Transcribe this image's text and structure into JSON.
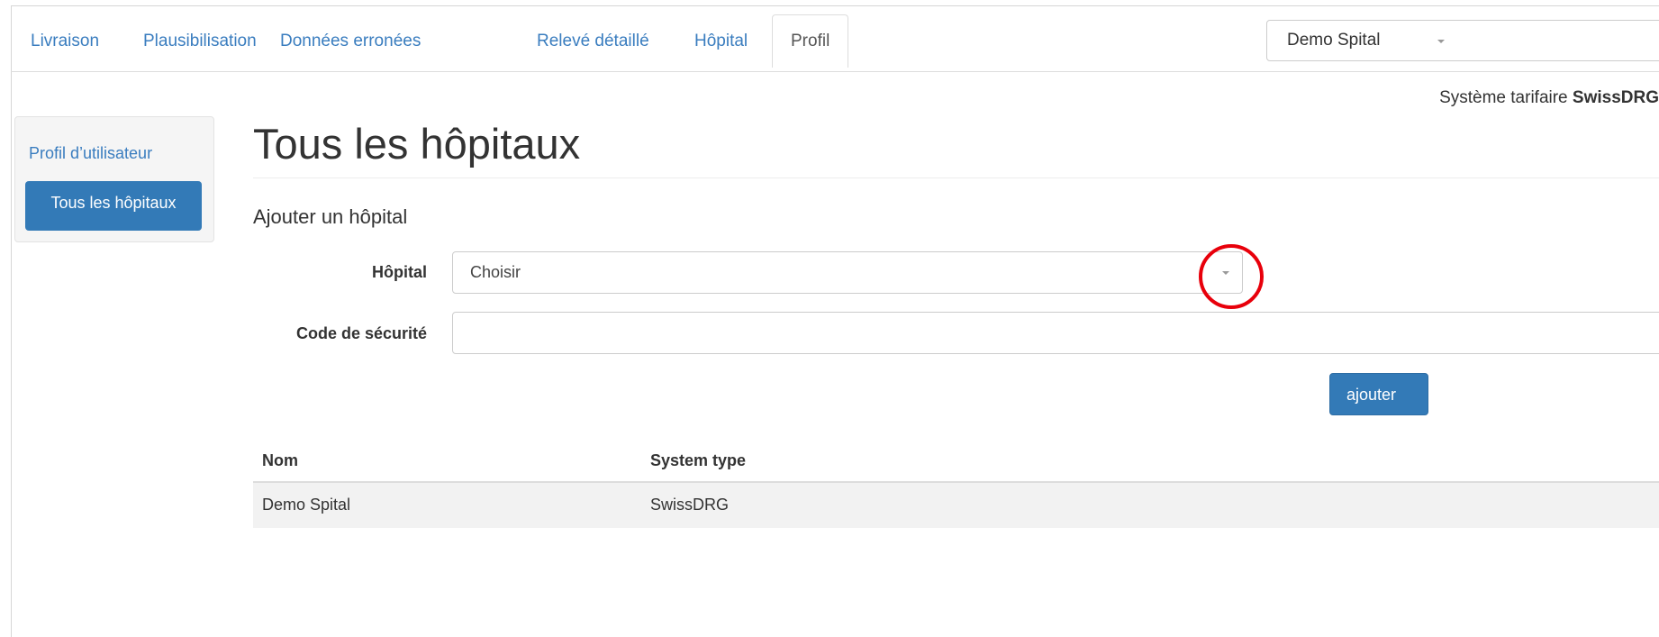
{
  "nav": {
    "tabs": [
      {
        "label": "Livraison"
      },
      {
        "label": "Plausibilisation"
      },
      {
        "label": "Données erronées"
      },
      {
        "label": "Relevé détaillé"
      },
      {
        "label": "Hôpital"
      },
      {
        "label": "Profil",
        "active": true
      }
    ],
    "hospital_selector": {
      "value": "Demo Spital"
    }
  },
  "tariff": {
    "label": "Système tarifaire",
    "value": "SwissDRG"
  },
  "sidebar": {
    "items": [
      {
        "label": "Profil d’utilisateur"
      },
      {
        "label": "Tous les hôpitaux",
        "active": true
      }
    ]
  },
  "main": {
    "title": "Tous les hôpitaux",
    "section_title": "Ajouter un hôpital",
    "form": {
      "hospital_label": "Hôpital",
      "hospital_select_value": "Choisir",
      "security_code_label": "Code de sécurité",
      "security_code_value": "",
      "add_button": "ajouter"
    },
    "table": {
      "columns": [
        "Nom",
        "System type"
      ],
      "rows": [
        [
          "Demo Spital",
          "SwissDRG"
        ]
      ]
    }
  },
  "colors": {
    "accent": "#337ab7",
    "link": "#3a7dbf",
    "highlight_circle": "#e8000b"
  }
}
